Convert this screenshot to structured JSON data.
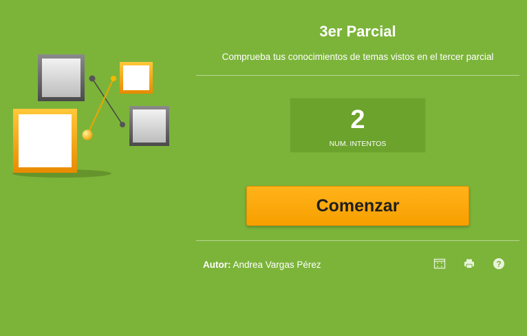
{
  "header": {
    "title": "3er Parcial",
    "subtitle": "Comprueba tus conocimientos de temas vistos en el tercer parcial"
  },
  "attempts": {
    "value": "2",
    "label": "NUM. INTENTOS"
  },
  "start_button": {
    "label": "Comenzar"
  },
  "footer": {
    "author_label": "Autor:",
    "author_name": "Andrea Vargas Pérez",
    "icons": [
      "fullscreen-icon",
      "print-icon",
      "help-icon"
    ]
  },
  "colors": {
    "background": "#7cb43a",
    "button": "#f9a300",
    "panel": "#6ca32c"
  }
}
